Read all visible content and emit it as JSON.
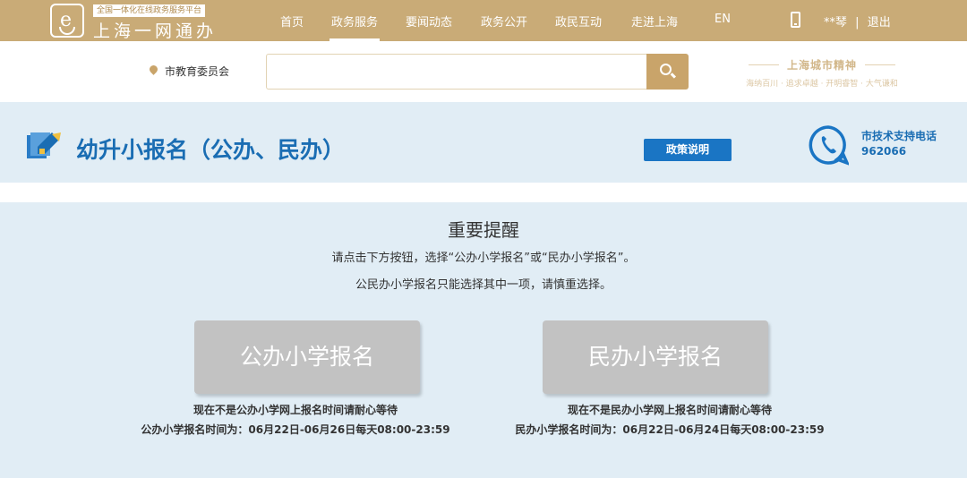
{
  "header": {
    "logo_tag": "全国一体化在线政务服务平台",
    "logo_name": "上海一网通办",
    "nav": [
      {
        "label": "首页",
        "active": false
      },
      {
        "label": "政务服务",
        "active": true
      },
      {
        "label": "要闻动态",
        "active": false
      },
      {
        "label": "政务公开",
        "active": false
      },
      {
        "label": "政民互动",
        "active": false
      },
      {
        "label": "走进上海",
        "active": false
      },
      {
        "label": "EN",
        "active": false
      }
    ],
    "user_name": "**琴",
    "separator": "|",
    "logout_label": "退出"
  },
  "search": {
    "location": "市教育委员会",
    "placeholder": "",
    "slogan_title": "上海城市精神",
    "slogan_sub": "海纳百川 · 追求卓越 · 开明睿智 · 大气谦和"
  },
  "service": {
    "title": "幼升小报名（公办、民办）",
    "policy_button": "政策说明",
    "support_label": "市技术支持电话",
    "support_number": "962066"
  },
  "notice": {
    "title": "重要提醒",
    "line1": "请点击下方按钮，选择“公办小学报名”或“民办小学报名”。",
    "line2": "公民办小学报名只能选择其中一项，请慎重选择。"
  },
  "registration": {
    "public": {
      "button": "公办小学报名",
      "wait": "现在不是公办小学网上报名时间请耐心等待",
      "time": "公办小学报名时间为：06月22日-06月26日每天08:00-23:59"
    },
    "private": {
      "button": "民办小学报名",
      "wait": "现在不是民办小学网上报名时间请耐心等待",
      "time": "民办小学报名时间为：06月22日-06月24日每天08:00-23:59"
    }
  },
  "colors": {
    "gold": "#c9ab77",
    "blue": "#1a6db3",
    "band": "#e1edf5",
    "disabled_button": "#c2c2c2"
  }
}
